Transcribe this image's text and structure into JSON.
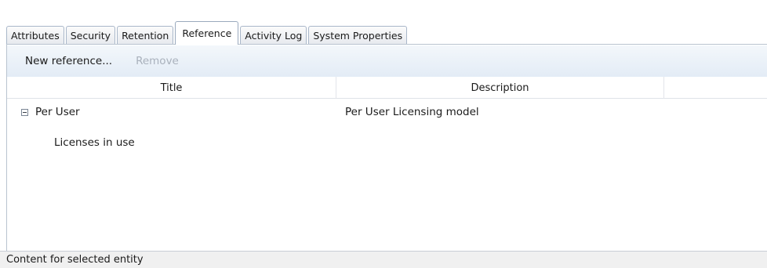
{
  "tabs": [
    {
      "label": "Attributes",
      "active": false
    },
    {
      "label": "Security",
      "active": false
    },
    {
      "label": "Retention",
      "active": false
    },
    {
      "label": "Reference",
      "active": true
    },
    {
      "label": "Activity Log",
      "active": false
    },
    {
      "label": "System Properties",
      "active": false
    }
  ],
  "toolbar": {
    "new_reference_label": "New reference...",
    "remove_label": "Remove"
  },
  "table": {
    "columns": [
      "Title",
      "Description",
      ""
    ],
    "rows": [
      {
        "title": "Per User",
        "description": "Per User Licensing model",
        "expanded": true
      },
      {
        "title": "Licenses in use",
        "description": ""
      }
    ]
  },
  "status": {
    "text": "Content for selected entity"
  },
  "colors": {
    "toolbar_bg": "#e3ecf6",
    "tab_border": "#a9b7c9",
    "disabled_text": "#a9b1bc"
  }
}
